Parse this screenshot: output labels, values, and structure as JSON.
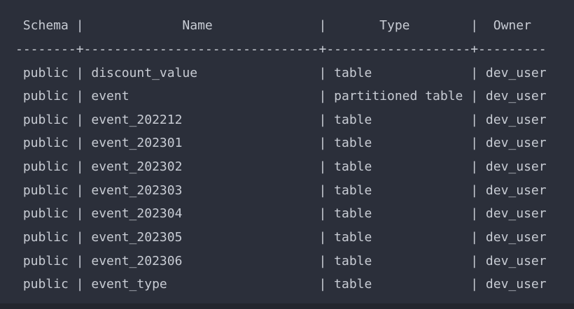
{
  "psql_output": {
    "header": " Schema |             Name              |       Type        |  Owner",
    "separator": "--------+-------------------------------+-------------------+---------",
    "rows": [
      " public | discount_value                | table             | dev_user",
      " public | event                         | partitioned table | dev_user",
      " public | event_202212                  | table             | dev_user",
      " public | event_202301                  | table             | dev_user",
      " public | event_202302                  | table             | dev_user",
      " public | event_202303                  | table             | dev_user",
      " public | event_202304                  | table             | dev_user",
      " public | event_202305                  | table             | dev_user",
      " public | event_202306                  | table             | dev_user",
      " public | event_type                    | table             | dev_user"
    ]
  },
  "colors": {
    "background": "#2b2f3a",
    "text": "#c8ccd4"
  }
}
